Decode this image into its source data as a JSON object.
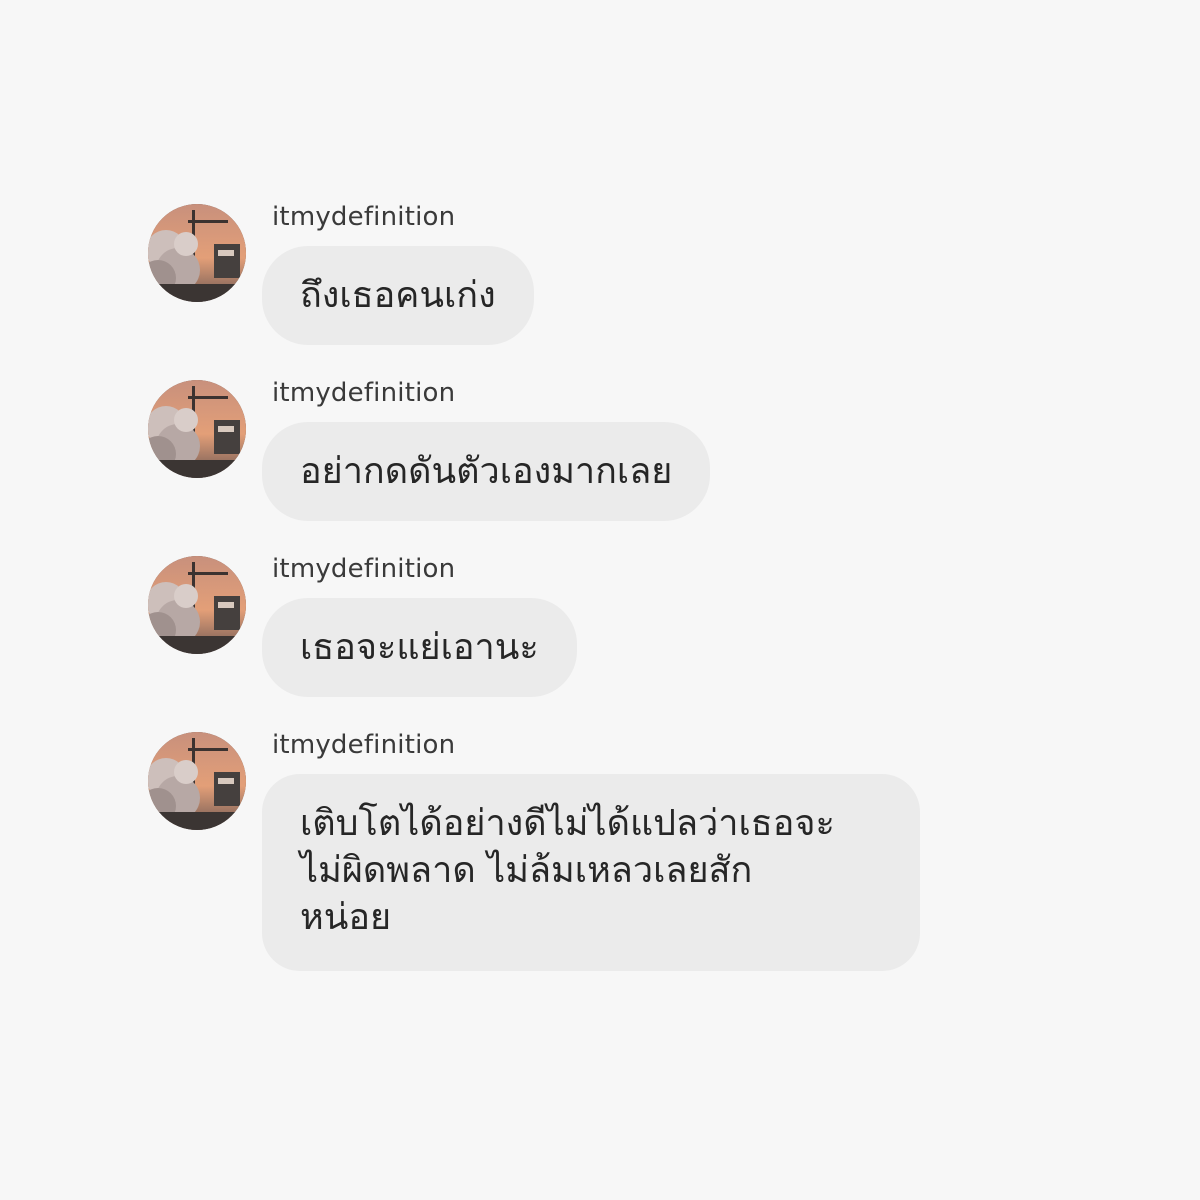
{
  "messages": [
    {
      "username": "itmydefinition",
      "lines": [
        "ถึงเธอคนเก่ง"
      ]
    },
    {
      "username": "itmydefinition",
      "lines": [
        "อย่ากดดันตัวเองมากเลย"
      ]
    },
    {
      "username": "itmydefinition",
      "lines": [
        "เธอจะแย่เอานะ"
      ]
    },
    {
      "username": "itmydefinition",
      "lines": [
        "เติบโตได้อย่างดีไม่ได้แปลว่าเธอจะ",
        "ไม่ผิดพลาด ไม่ล้มเหลวเลยสัก",
        "หน่อย"
      ]
    }
  ],
  "colors": {
    "background": "#f7f7f7",
    "bubble": "#ebebeb",
    "text": "#262626",
    "username": "#3a3a3a"
  }
}
